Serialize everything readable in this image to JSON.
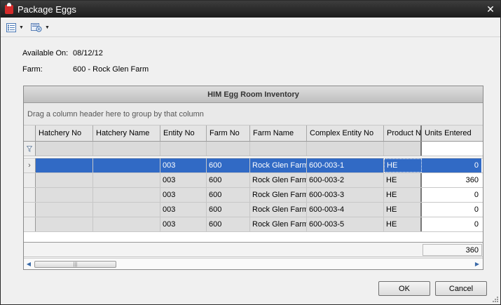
{
  "window": {
    "title": "Package Eggs"
  },
  "toolbar": {
    "icons": [
      "list-view-icon",
      "refresh-settings-icon"
    ]
  },
  "info": {
    "available_label": "Available On:",
    "available_value": "08/12/12",
    "farm_label": "Farm:",
    "farm_value": "600 - Rock Glen Farm"
  },
  "grid": {
    "title": "HIM Egg Room Inventory",
    "group_hint": "Drag a column header here to group by that column",
    "columns": [
      "Hatchery No",
      "Hatchery Name",
      "Entity No",
      "Farm No",
      "Farm Name",
      "Complex Entity No",
      "Product N",
      "Units Entered"
    ],
    "rows": [
      {
        "hatchery_no": "",
        "hatchery_name": "",
        "entity_no": "003",
        "farm_no": "600",
        "farm_name": "Rock Glen Farm",
        "complex": "600-003-1",
        "product": "HE",
        "units": "0"
      },
      {
        "hatchery_no": "",
        "hatchery_name": "",
        "entity_no": "003",
        "farm_no": "600",
        "farm_name": "Rock Glen Farm",
        "complex": "600-003-2",
        "product": "HE",
        "units": "360"
      },
      {
        "hatchery_no": "",
        "hatchery_name": "",
        "entity_no": "003",
        "farm_no": "600",
        "farm_name": "Rock Glen Farm",
        "complex": "600-003-3",
        "product": "HE",
        "units": "0"
      },
      {
        "hatchery_no": "",
        "hatchery_name": "",
        "entity_no": "003",
        "farm_no": "600",
        "farm_name": "Rock Glen Farm",
        "complex": "600-003-4",
        "product": "HE",
        "units": "0"
      },
      {
        "hatchery_no": "",
        "hatchery_name": "",
        "entity_no": "003",
        "farm_no": "600",
        "farm_name": "Rock Glen Farm",
        "complex": "600-003-5",
        "product": "HE",
        "units": "0"
      }
    ],
    "selected_row": 0,
    "total_units": "360"
  },
  "buttons": {
    "ok": "OK",
    "cancel": "Cancel"
  },
  "colors": {
    "titlebar": "#1c1c1c",
    "selection": "#316ac5"
  }
}
